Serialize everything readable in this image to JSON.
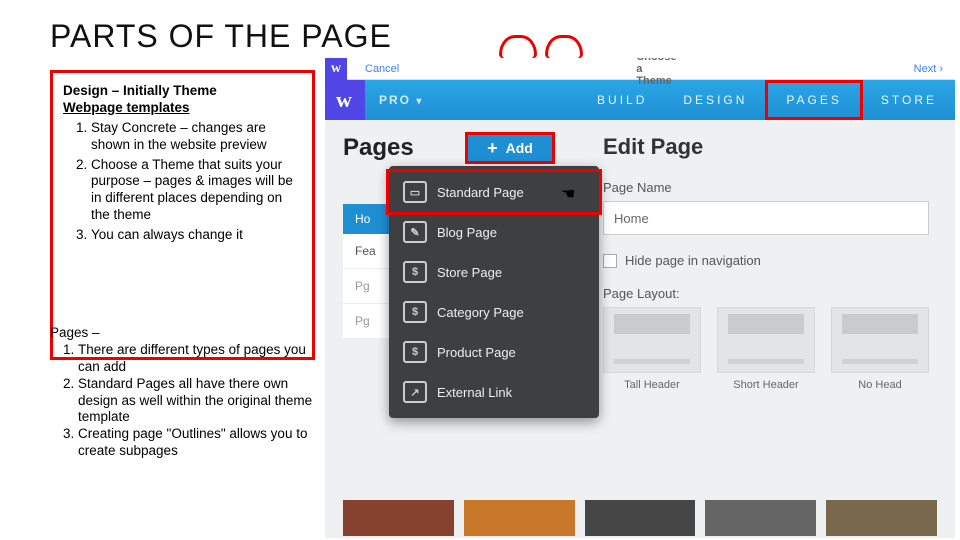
{
  "title": "PARTS OF THE PAGE",
  "design": {
    "heading": "Design – Initially Theme",
    "sub": "Webpage templates",
    "items": [
      "Stay Concrete – changes are shown in the website preview",
      "Choose a Theme that suits your purpose – pages & images will be in different places depending on the theme",
      "You can always change it"
    ]
  },
  "pages": {
    "heading": "Pages –",
    "items": [
      "There are different types of pages you can add",
      "Standard Pages all have there own design as well within the original theme template",
      "Creating page \"Outlines\" allows you to create subpages"
    ]
  },
  "topbar": {
    "cancel": "Cancel",
    "mid": "Choose a Theme",
    "next": "Next ›"
  },
  "nav": {
    "pro": "PRO",
    "items": [
      "BUILD",
      "DESIGN",
      "PAGES",
      "STORE"
    ]
  },
  "leftcol": {
    "title": "Pages",
    "add": "Add",
    "home": "Ho",
    "rows": [
      "Fea",
      "Pg",
      "Pg"
    ]
  },
  "menu": {
    "items": [
      {
        "icon": "▭",
        "label": "Standard Page"
      },
      {
        "icon": "✎",
        "label": "Blog Page"
      },
      {
        "icon": "$",
        "label": "Store Page"
      },
      {
        "icon": "$",
        "label": "Category Page"
      },
      {
        "icon": "$",
        "label": "Product Page"
      },
      {
        "icon": "↗",
        "label": "External Link"
      }
    ]
  },
  "right": {
    "title": "Edit Page",
    "pname": "Page Name",
    "home": "Home",
    "hide": "Hide page in navigation",
    "layout": "Page Layout:",
    "thumbs": [
      "Tall Header",
      "Short Header",
      "No Head"
    ]
  }
}
